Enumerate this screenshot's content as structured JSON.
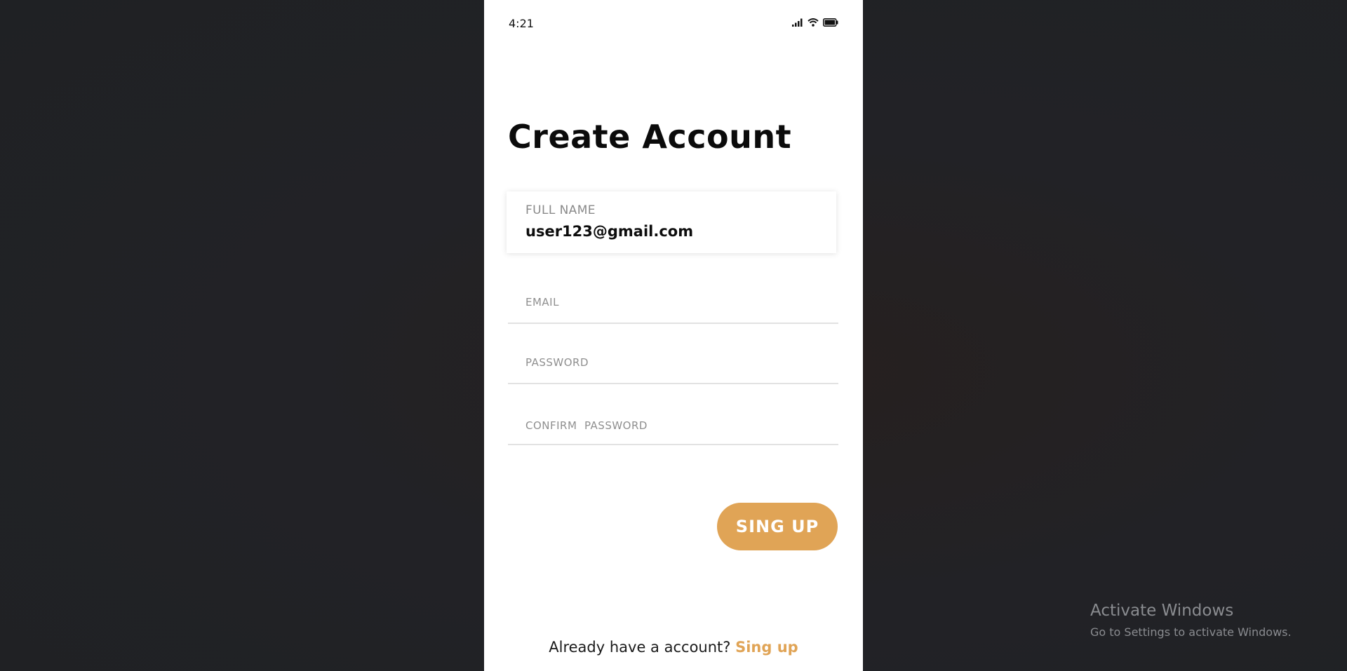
{
  "status_bar": {
    "time": "4:21",
    "icons": [
      "signal-icon",
      "wifi-icon",
      "battery-icon"
    ]
  },
  "screen": {
    "title": "Create Account",
    "fields": {
      "full_name": {
        "label": "FULL NAME",
        "value": "user123@gmail.com"
      },
      "email": {
        "placeholder": "EMAIL"
      },
      "password": {
        "placeholder": "PASSWORD"
      },
      "confirm_password": {
        "placeholder": "CONFIRM  PASSWORD"
      }
    },
    "signup_button": "SING UP",
    "footer": {
      "prompt": "Already have a account?",
      "link": "Sing up"
    }
  },
  "watermark": {
    "title": "Activate Windows",
    "subtitle": "Go to Settings to activate Windows."
  },
  "colors": {
    "accent": "#e0a456",
    "background": "#222226",
    "surface": "#ffffff"
  }
}
